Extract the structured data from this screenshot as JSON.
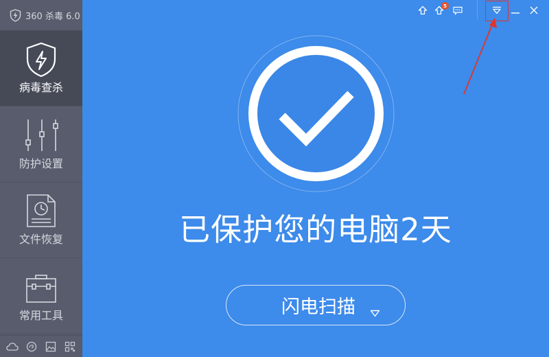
{
  "app": {
    "title": "360 杀毒 6.0"
  },
  "sidebar": {
    "items": [
      {
        "label": "病毒查杀",
        "icon": "shield-bolt-icon",
        "active": true
      },
      {
        "label": "防护设置",
        "icon": "sliders-icon",
        "active": false
      },
      {
        "label": "文件恢复",
        "icon": "file-restore-icon",
        "active": false
      },
      {
        "label": "常用工具",
        "icon": "toolbox-icon",
        "active": false
      }
    ],
    "bottom_icons": [
      "cloud-icon",
      "swirl-icon",
      "image-icon",
      "qrcode-icon"
    ]
  },
  "titlebar": {
    "upload_icon": "upload-icon",
    "update_icon": "update-icon",
    "update_badge": "5",
    "message_icon": "message-icon",
    "menu_icon": "dropdown-menu-icon",
    "minimize_icon": "minimize-icon",
    "close_icon": "close-icon"
  },
  "main": {
    "status_icon": "check-circle-icon",
    "status_text": "已保护您的电脑2天",
    "scan_button": {
      "label": "闪电扫描",
      "dropdown_icon": "triangle-down-icon"
    }
  },
  "annotation": {
    "highlight_color": "#e0342c"
  },
  "colors": {
    "accent": "#3d8bea",
    "sidebar": "#585c6c",
    "sidebar_active": "#464a57"
  }
}
